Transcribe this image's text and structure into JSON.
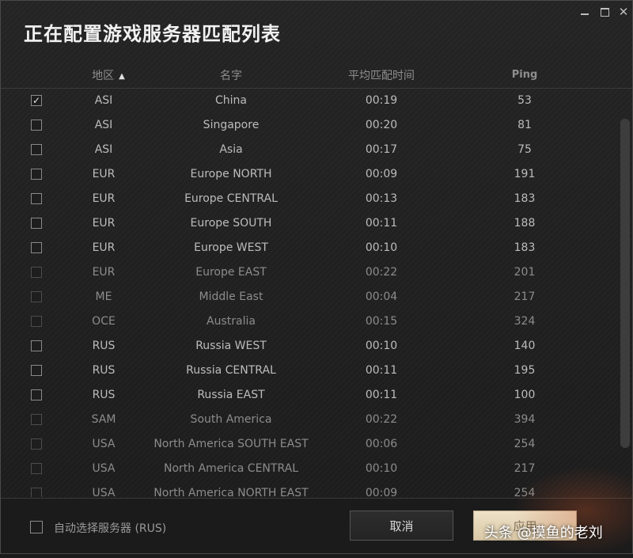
{
  "window": {
    "title": "正在配置游戏服务器匹配列表",
    "controls": {
      "close": "✕"
    }
  },
  "columns": {
    "region": "地区",
    "name": "名字",
    "avg_time": "平均匹配时间",
    "ping": "Ping",
    "sort_icon": "chevron-up-icon"
  },
  "servers": [
    {
      "region": "ASI",
      "name": "China",
      "time": "00:19",
      "ping": "53",
      "checked": true,
      "enabled": true
    },
    {
      "region": "ASI",
      "name": "Singapore",
      "time": "00:20",
      "ping": "81",
      "checked": false,
      "enabled": true
    },
    {
      "region": "ASI",
      "name": "Asia",
      "time": "00:17",
      "ping": "75",
      "checked": false,
      "enabled": true
    },
    {
      "region": "EUR",
      "name": "Europe NORTH",
      "time": "00:09",
      "ping": "191",
      "checked": false,
      "enabled": true
    },
    {
      "region": "EUR",
      "name": "Europe CENTRAL",
      "time": "00:13",
      "ping": "183",
      "checked": false,
      "enabled": true
    },
    {
      "region": "EUR",
      "name": "Europe SOUTH",
      "time": "00:11",
      "ping": "188",
      "checked": false,
      "enabled": true
    },
    {
      "region": "EUR",
      "name": "Europe WEST",
      "time": "00:10",
      "ping": "183",
      "checked": false,
      "enabled": true
    },
    {
      "region": "EUR",
      "name": "Europe EAST",
      "time": "00:22",
      "ping": "201",
      "checked": false,
      "enabled": false
    },
    {
      "region": "ME",
      "name": "Middle East",
      "time": "00:04",
      "ping": "217",
      "checked": false,
      "enabled": false
    },
    {
      "region": "OCE",
      "name": "Australia",
      "time": "00:15",
      "ping": "324",
      "checked": false,
      "enabled": false
    },
    {
      "region": "RUS",
      "name": "Russia WEST",
      "time": "00:10",
      "ping": "140",
      "checked": false,
      "enabled": true
    },
    {
      "region": "RUS",
      "name": "Russia CENTRAL",
      "time": "00:11",
      "ping": "195",
      "checked": false,
      "enabled": true
    },
    {
      "region": "RUS",
      "name": "Russia EAST",
      "time": "00:11",
      "ping": "100",
      "checked": false,
      "enabled": true
    },
    {
      "region": "SAM",
      "name": "South America",
      "time": "00:22",
      "ping": "394",
      "checked": false,
      "enabled": false
    },
    {
      "region": "USA",
      "name": "North America SOUTH EAST",
      "time": "00:06",
      "ping": "254",
      "checked": false,
      "enabled": false
    },
    {
      "region": "USA",
      "name": "North America CENTRAL",
      "time": "00:10",
      "ping": "217",
      "checked": false,
      "enabled": false
    },
    {
      "region": "USA",
      "name": "North America NORTH EAST",
      "time": "00:09",
      "ping": "254",
      "checked": false,
      "enabled": false
    }
  ],
  "footer": {
    "auto_select_label": "自动选择服务器 (RUS)",
    "cancel_label": "取消",
    "apply_label": "应用"
  },
  "watermark": "头条 @摸鱼的老刘",
  "colors": {
    "background": "#1c1c1c",
    "apply_button": "#e6d7b8",
    "text": "#bcbcbc"
  }
}
